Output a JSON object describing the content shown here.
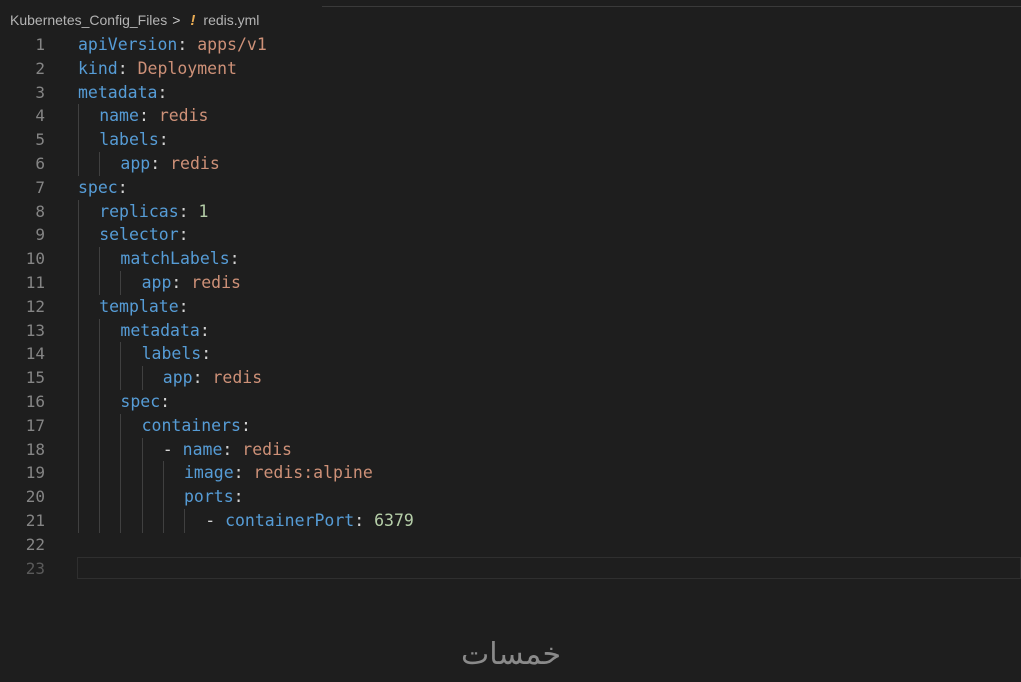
{
  "breadcrumb": {
    "folder": "Kubernetes_Config_Files",
    "separator": ">",
    "file_icon": "yaml-exclamation-icon",
    "file_icon_glyph": "!",
    "file": "redis.yml"
  },
  "colors": {
    "background": "#1e1e1e",
    "key": "#569cd6",
    "string": "#ce9178",
    "number": "#b5cea8",
    "punctuation": "#d4d4d4",
    "line_number": "#858585",
    "icon_yaml": "#e8ab53"
  },
  "editor": {
    "lines": [
      {
        "num": "1",
        "indent": 0,
        "dash": false,
        "key": "apiVersion",
        "value": "apps/v1",
        "vtype": "string"
      },
      {
        "num": "2",
        "indent": 0,
        "dash": false,
        "key": "kind",
        "value": "Deployment",
        "vtype": "string"
      },
      {
        "num": "3",
        "indent": 0,
        "dash": false,
        "key": "metadata",
        "value": "",
        "vtype": ""
      },
      {
        "num": "4",
        "indent": 1,
        "dash": false,
        "key": "name",
        "value": "redis",
        "vtype": "string"
      },
      {
        "num": "5",
        "indent": 1,
        "dash": false,
        "key": "labels",
        "value": "",
        "vtype": ""
      },
      {
        "num": "6",
        "indent": 2,
        "dash": false,
        "key": "app",
        "value": "redis",
        "vtype": "string"
      },
      {
        "num": "7",
        "indent": 0,
        "dash": false,
        "key": "spec",
        "value": "",
        "vtype": ""
      },
      {
        "num": "8",
        "indent": 1,
        "dash": false,
        "key": "replicas",
        "value": "1",
        "vtype": "number"
      },
      {
        "num": "9",
        "indent": 1,
        "dash": false,
        "key": "selector",
        "value": "",
        "vtype": ""
      },
      {
        "num": "10",
        "indent": 2,
        "dash": false,
        "key": "matchLabels",
        "value": "",
        "vtype": ""
      },
      {
        "num": "11",
        "indent": 3,
        "dash": false,
        "key": "app",
        "value": "redis",
        "vtype": "string"
      },
      {
        "num": "12",
        "indent": 1,
        "dash": false,
        "key": "template",
        "value": "",
        "vtype": ""
      },
      {
        "num": "13",
        "indent": 2,
        "dash": false,
        "key": "metadata",
        "value": "",
        "vtype": ""
      },
      {
        "num": "14",
        "indent": 3,
        "dash": false,
        "key": "labels",
        "value": "",
        "vtype": ""
      },
      {
        "num": "15",
        "indent": 4,
        "dash": false,
        "key": "app",
        "value": "redis",
        "vtype": "string"
      },
      {
        "num": "16",
        "indent": 2,
        "dash": false,
        "key": "spec",
        "value": "",
        "vtype": ""
      },
      {
        "num": "17",
        "indent": 3,
        "dash": false,
        "key": "containers",
        "value": "",
        "vtype": ""
      },
      {
        "num": "18",
        "indent": 4,
        "dash": true,
        "key": "name",
        "value": "redis",
        "vtype": "string"
      },
      {
        "num": "19",
        "indent": 5,
        "dash": false,
        "key": "image",
        "value": "redis:alpine",
        "vtype": "string"
      },
      {
        "num": "20",
        "indent": 5,
        "dash": false,
        "key": "ports",
        "value": "",
        "vtype": ""
      },
      {
        "num": "21",
        "indent": 6,
        "dash": true,
        "key": "containerPort",
        "value": "6379",
        "vtype": "number"
      },
      {
        "num": "22",
        "indent": 0,
        "dash": false,
        "key": "",
        "value": "",
        "vtype": ""
      },
      {
        "num": "23",
        "indent": 0,
        "dash": false,
        "key": "",
        "value": "",
        "vtype": "",
        "current": true
      }
    ]
  },
  "watermark": {
    "text": "خمسات"
  }
}
